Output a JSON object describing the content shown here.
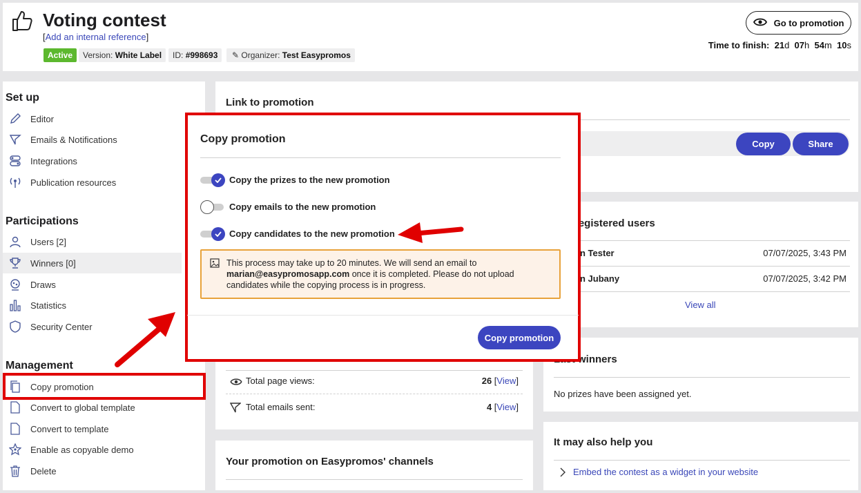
{
  "header": {
    "title": "Voting contest",
    "ref_link": "Add an internal reference",
    "status": "Active",
    "version_label": "Version:",
    "version_value": "White Label",
    "id_label": "ID:",
    "id_value": "#998693",
    "organizer_label": "Organizer:",
    "organizer_value": "Test Easypromos",
    "go_button": "Go to promotion",
    "timer_label": "Time to finish:",
    "timer": {
      "d": "21",
      "h": "07",
      "m": "54",
      "s": "10"
    }
  },
  "sidebar": {
    "setup_title": "Set up",
    "setup": [
      "Editor",
      "Emails & Notifications",
      "Integrations",
      "Publication resources"
    ],
    "participations_title": "Participations",
    "participations": [
      "Users [2]",
      "Winners [0]",
      "Draws",
      "Statistics",
      "Security Center"
    ],
    "management_title": "Management",
    "management": [
      "Copy promotion",
      "Convert to global template",
      "Convert to template",
      "Enable as copyable demo",
      "Delete"
    ]
  },
  "link_card": {
    "title": "Link to promotion",
    "copy": "Copy",
    "share": "Share"
  },
  "users_card": {
    "title": "registered users",
    "rows": [
      {
        "name": "n Tester",
        "date": "07/07/2025, 3:43 PM"
      },
      {
        "name": "n Jubany",
        "date": "07/07/2025, 3:42 PM"
      }
    ],
    "view_all": "View all"
  },
  "stats": {
    "page_views_label": "Total page views:",
    "page_views_value": "26",
    "emails_label": "Total emails sent:",
    "emails_value": "4",
    "view_link": "View"
  },
  "winners_card": {
    "title": "Last winners",
    "empty": "No prizes have been assigned yet."
  },
  "channels_card": {
    "title": "Your promotion on Easypromos' channels"
  },
  "help_card": {
    "title": "It may also help you",
    "item": "Embed the contest as a widget in your website"
  },
  "modal": {
    "title": "Copy promotion",
    "options": [
      {
        "label": "Copy the prizes to the new promotion",
        "on": true
      },
      {
        "label": "Copy emails to the new promotion",
        "on": false
      },
      {
        "label": "Copy candidates to the new promotion",
        "on": true
      }
    ],
    "warning_pre": "This process may take up to 20 minutes. We will send an email to",
    "warning_email": "marian@easypromosapp.com",
    "warning_post": "once it is completed. Please do not upload candidates while the copying process is in progress.",
    "button": "Copy promotion"
  },
  "colors": {
    "accent": "#3c45c0",
    "annotation": "#e00000",
    "active": "#5cb82e",
    "warning_border": "#e8a23a"
  }
}
